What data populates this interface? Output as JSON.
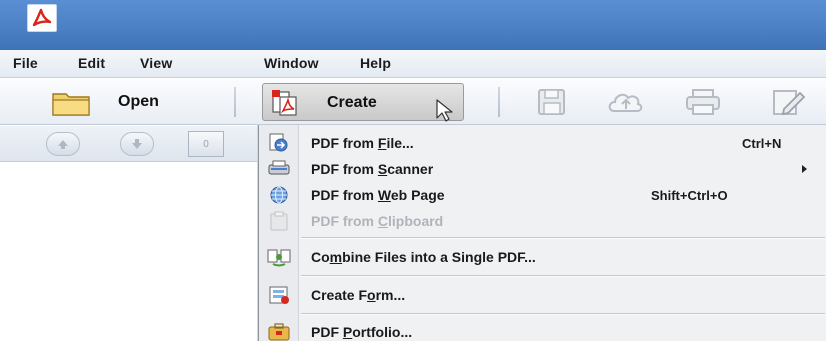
{
  "titlebar": {
    "logo_icon": "acrobat-logo-icon",
    "color": "#4a7fc4"
  },
  "menubar": {
    "items": [
      "File",
      "Edit",
      "View",
      "Window",
      "Help"
    ]
  },
  "toolbar": {
    "open_label": "Open",
    "create_label": "Create",
    "icons": [
      "save-icon",
      "cloud-upload-icon",
      "print-icon",
      "edit-icon"
    ]
  },
  "leftpanel": {
    "nav_buttons": [
      "up-arrow-icon",
      "down-arrow-icon"
    ],
    "page_box_label": "0"
  },
  "create_menu": {
    "items": [
      {
        "pre": "PDF from ",
        "mn": "F",
        "post": "ile...",
        "shortcut": "Ctrl+N",
        "icon": "pdf-from-file-icon",
        "enabled": true
      },
      {
        "pre": "PDF from ",
        "mn": "S",
        "post": "canner",
        "shortcut": "",
        "submenu": true,
        "icon": "scanner-icon",
        "enabled": true
      },
      {
        "pre": "PDF from ",
        "mn": "W",
        "post": "eb Page",
        "shortcut": "Shift+Ctrl+O",
        "icon": "web-page-icon",
        "enabled": true
      },
      {
        "pre": "PDF from ",
        "mn": "C",
        "post": "lipboard",
        "shortcut": "",
        "icon": "clipboard-icon",
        "enabled": false
      },
      {
        "pre": "Co",
        "mn": "m",
        "post": "bine Files into a Single PDF...",
        "shortcut": "",
        "icon": "combine-files-icon",
        "enabled": true
      },
      {
        "pre": "Create F",
        "mn": "o",
        "post": "rm...",
        "shortcut": "",
        "icon": "create-form-icon",
        "enabled": true
      },
      {
        "pre": "PDF ",
        "mn": "P",
        "post": "ortfolio...",
        "shortcut": "",
        "icon": "portfolio-icon",
        "enabled": true
      }
    ]
  }
}
